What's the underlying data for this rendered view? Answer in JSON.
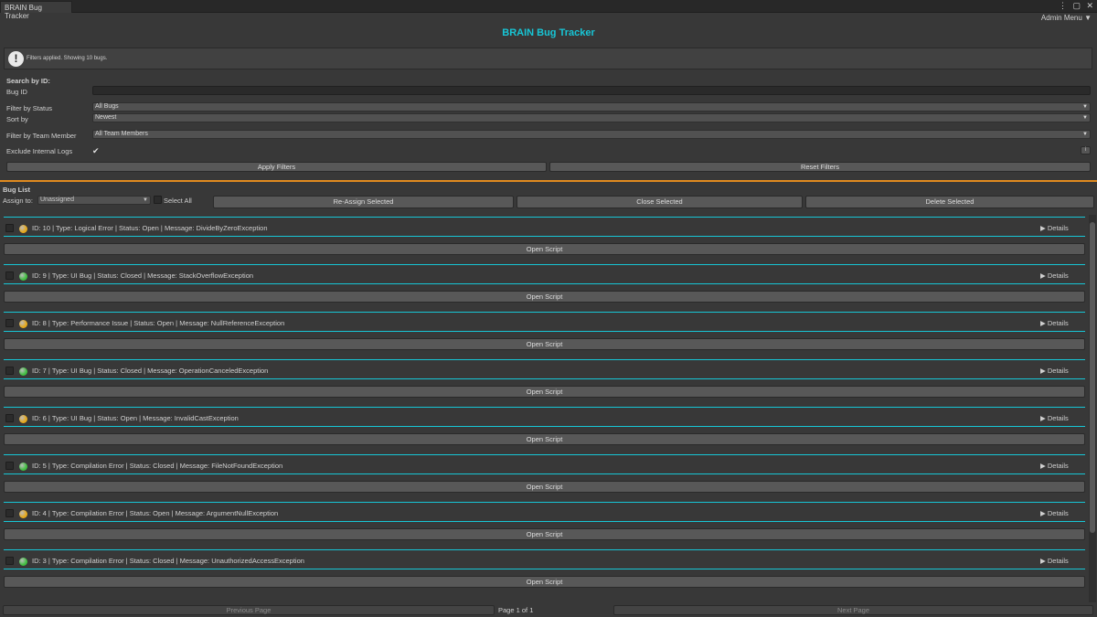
{
  "window": {
    "tab_label": "BRAIN Bug Tracker",
    "admin_menu": "Admin Menu"
  },
  "header": {
    "title": "BRAIN Bug Tracker"
  },
  "info": {
    "message": "Filters applied. Showing 10 bugs."
  },
  "filters": {
    "search_heading": "Search by ID:",
    "bug_id_label": "Bug ID",
    "bug_id_value": "",
    "status_label": "Filter by Status",
    "status_value": "All Bugs",
    "sort_label": "Sort by",
    "sort_value": "Newest",
    "team_label": "Filter by Team Member",
    "team_value": "All Team Members",
    "exclude_label": "Exclude Internal Logs",
    "exclude_checked": true,
    "small_button": "i",
    "apply": "Apply Filters",
    "reset": "Reset Filters"
  },
  "list": {
    "heading": "Bug List",
    "assign_label": "Assign to:",
    "assign_value": "Unassigned",
    "select_all": "Select All",
    "reassign": "Re-Assign Selected",
    "close": "Close Selected",
    "delete": "Delete Selected",
    "details_label": "Details",
    "open_script": "Open Script",
    "status_colors": {
      "Open": "#e6a817",
      "Closed": "#3fbf3f"
    },
    "bugs": [
      {
        "text": "ID: 10 | Type: Logical Error | Status: Open | Message: DivideByZeroException",
        "status": "Open"
      },
      {
        "text": "ID: 9 | Type: UI Bug | Status: Closed | Message: StackOverflowException",
        "status": "Closed"
      },
      {
        "text": "ID: 8 | Type: Performance Issue | Status: Open | Message: NullReferenceException",
        "status": "Open"
      },
      {
        "text": "ID: 7 | Type: UI Bug | Status: Closed | Message: OperationCanceledException",
        "status": "Closed"
      },
      {
        "text": "ID: 6 | Type: UI Bug | Status: Open | Message: InvalidCastException",
        "status": "Open"
      },
      {
        "text": "ID: 5 | Type: Compilation Error | Status: Closed | Message: FileNotFoundException",
        "status": "Closed"
      },
      {
        "text": "ID: 4 | Type: Compilation Error | Status: Open | Message: ArgumentNullException",
        "status": "Open"
      },
      {
        "text": "ID: 3 | Type: Compilation Error | Status: Closed | Message: UnauthorizedAccessException",
        "status": "Closed"
      }
    ]
  },
  "pagination": {
    "previous": "Previous Page",
    "page_label": "Page 1 of 1",
    "next": "Next Page"
  }
}
